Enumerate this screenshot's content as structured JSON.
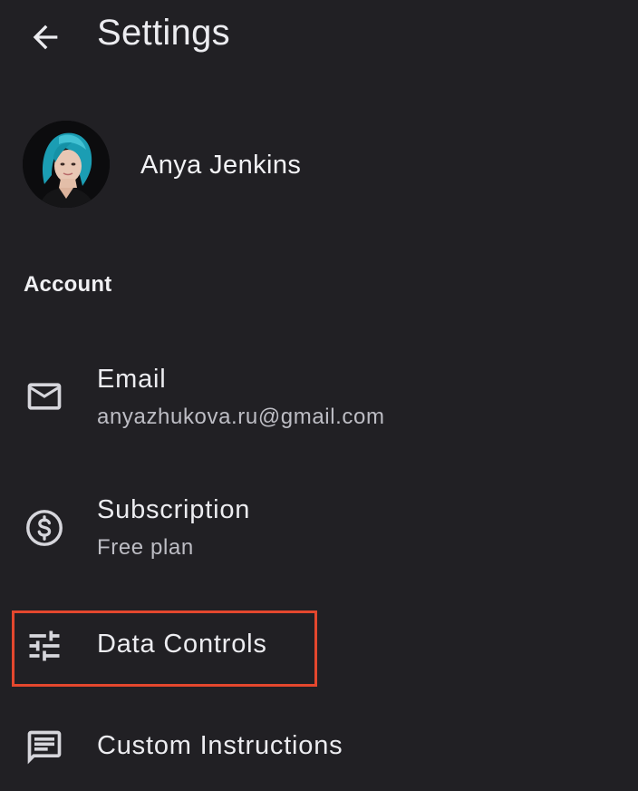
{
  "appbar": {
    "back_icon": "arrow-back-icon",
    "title": "Settings"
  },
  "profile": {
    "name": "Anya Jenkins",
    "avatar": "avatar-photo"
  },
  "section": {
    "account_label": "Account"
  },
  "items": [
    {
      "id": "email",
      "icon": "mail-icon",
      "title": "Email",
      "subtitle": "anyazhukova.ru@gmail.com"
    },
    {
      "id": "subscription",
      "icon": "dollar-circle-icon",
      "title": "Subscription",
      "subtitle": "Free plan"
    },
    {
      "id": "data-controls",
      "icon": "sliders-icon",
      "title": "Data Controls"
    },
    {
      "id": "custom-instructions",
      "icon": "message-icon",
      "title": "Custom Instructions"
    }
  ],
  "colors": {
    "background": "#212024",
    "text_primary": "#ececf0",
    "text_secondary": "#bdbdc4",
    "highlight": "#e4472e",
    "avatar_hair": "#1fa3b8"
  }
}
